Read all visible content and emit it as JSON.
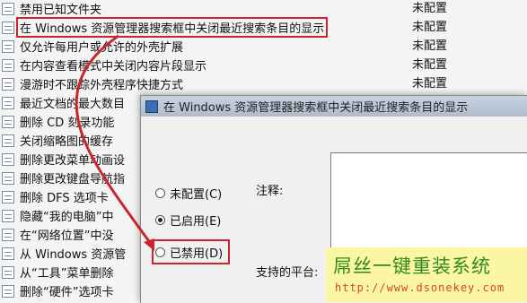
{
  "policies": {
    "status_value": "未配置",
    "items": [
      {
        "label": "禁用已知文件夹",
        "status": "未配置"
      },
      {
        "label": "在 Windows 资源管理器搜索框中关闭最近搜索条目的显示",
        "status": "未配置"
      },
      {
        "label": "仅允许每用户或允许的外壳扩展",
        "status": "未配置"
      },
      {
        "label": "在内容查看模式中关闭内容片段显示",
        "status": "未配置"
      },
      {
        "label": "漫游时不跟踪外壳程序快捷方式",
        "status": "未配置"
      },
      {
        "label": "最近文档的最大数目",
        "status": ""
      },
      {
        "label": "删除 CD 刻录功能",
        "status": ""
      },
      {
        "label": "关闭缩略图的缓存",
        "status": ""
      },
      {
        "label": "删除更改菜单动画设",
        "status": ""
      },
      {
        "label": "删除更改键盘导航指",
        "status": ""
      },
      {
        "label": "删除 DFS 选项卡",
        "status": ""
      },
      {
        "label": "隐藏“我的电脑”中",
        "status": ""
      },
      {
        "label": "在“网络位置”中没",
        "status": ""
      },
      {
        "label": "从 Windows 资源管",
        "status": ""
      },
      {
        "label": "从“工具”菜单删除",
        "status": ""
      },
      {
        "label": "删除“硬件”选项卡",
        "status": ""
      }
    ]
  },
  "dialog": {
    "title": "在 Windows 资源管理器搜索框中关闭最近搜索条目的显示",
    "options": [
      {
        "label": "未配置(C)",
        "checked": false
      },
      {
        "label": "已启用(E)",
        "checked": true
      },
      {
        "label": "已禁用(D)",
        "checked": false
      }
    ],
    "comment_label": "注释:",
    "platform_label": "支持的平台:"
  },
  "watermark": {
    "title": "屌丝一键重装系统",
    "url": "http://www.dsonekey.com"
  },
  "colors": {
    "highlight": "#c9252c",
    "watermark_bg": "#fbf6a4",
    "watermark_title": "#2f8a1f",
    "watermark_url": "#d44a14"
  }
}
